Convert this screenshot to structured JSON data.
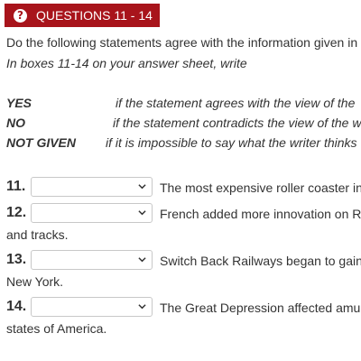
{
  "header": {
    "title": "QUESTIONS 11 - 14",
    "icon": "question-circle-icon",
    "color": "#a8141b"
  },
  "instructions": {
    "line1": "Do the following statements agree with the information given in",
    "line2": "In boxes 11-14 on your answer sheet, write"
  },
  "codes": [
    {
      "label": "YES",
      "desc": "if the statement agrees with the view of the"
    },
    {
      "label": "NO",
      "desc": "if the statement contradicts the view of the w"
    },
    {
      "label": "NOT GIVEN",
      "desc": "if it is impossible to say what the writer thinks"
    }
  ],
  "questions": [
    {
      "number": "11.",
      "selected": "",
      "text": "The most expensive roller coaster in",
      "cont": ""
    },
    {
      "number": "12.",
      "selected": "",
      "text": "French added more innovation on R",
      "cont": "and tracks."
    },
    {
      "number": "13.",
      "selected": "",
      "text": "Switch Back Railways began to gain",
      "cont": "New York."
    },
    {
      "number": "14.",
      "selected": "",
      "text": "The Great Depression affected amu",
      "cont": "states of America."
    }
  ]
}
